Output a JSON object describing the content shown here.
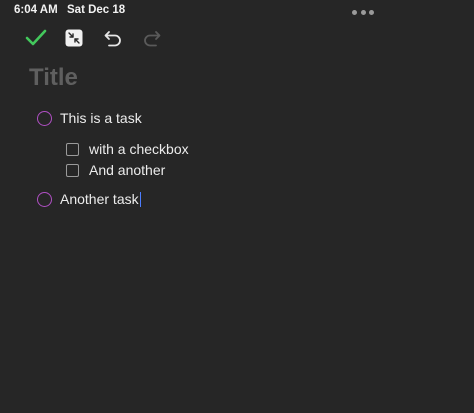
{
  "status_bar": {
    "time": "6:04 AM",
    "date": "Sat Dec 18"
  },
  "toolbar": {
    "done_icon": "checkmark-icon",
    "collapse_icon": "collapse-arrows-icon",
    "undo_icon": "undo-icon",
    "redo_icon": "redo-icon",
    "more_icon": "more-dots-icon"
  },
  "colors": {
    "background": "#262626",
    "check_green": "#43c85c",
    "task_circle": "#b04fc4",
    "title_placeholder": "#5f5f5f",
    "caret": "#4c7dff"
  },
  "note": {
    "title_placeholder": "Title",
    "tasks": [
      {
        "label": "This is a task",
        "subtasks": [
          {
            "label": "with a checkbox"
          },
          {
            "label": "And another"
          }
        ]
      },
      {
        "label": "Another task",
        "subtasks": []
      }
    ]
  }
}
